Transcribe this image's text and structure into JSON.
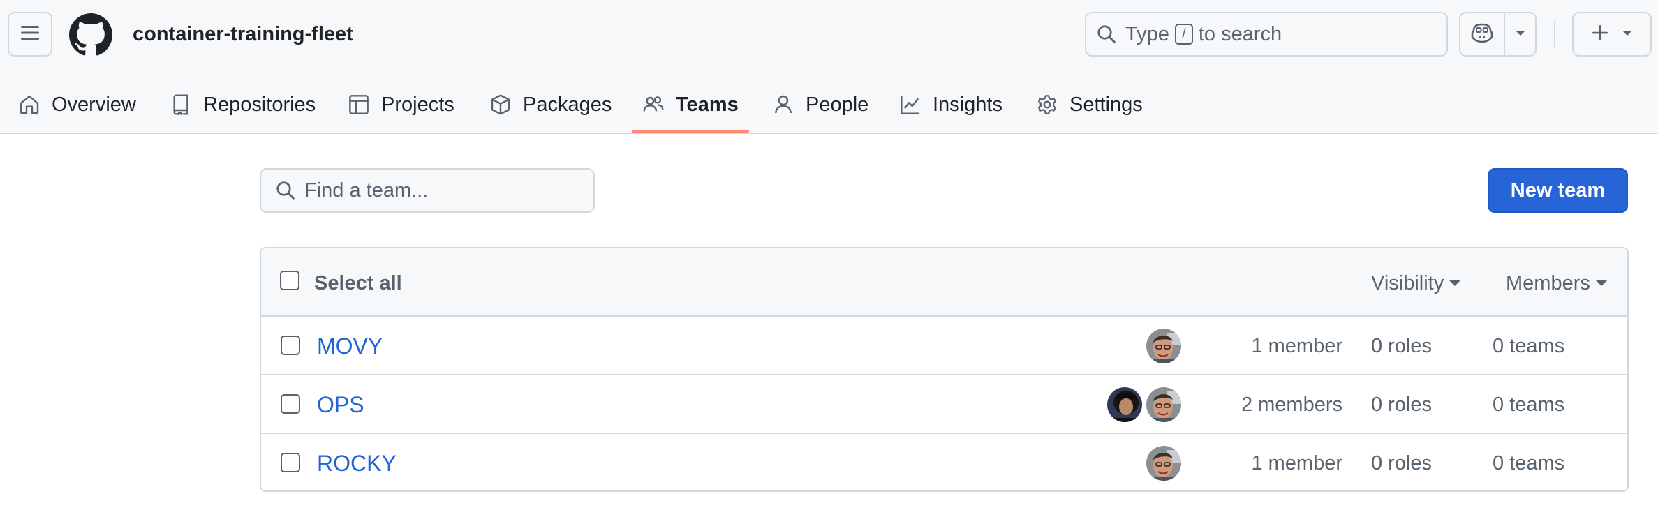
{
  "header": {
    "org_name": "container-training-fleet",
    "search": {
      "prefix": "Type",
      "key": "/",
      "suffix": "to search"
    },
    "icons": {
      "menu": "hamburger-icon",
      "logo": "github-logo",
      "copilot": "copilot-icon",
      "create": "plus-icon"
    }
  },
  "nav": {
    "tabs": [
      {
        "label": "Overview",
        "icon": "home-icon",
        "active": false
      },
      {
        "label": "Repositories",
        "icon": "repo-icon",
        "active": false
      },
      {
        "label": "Projects",
        "icon": "table-icon",
        "active": false
      },
      {
        "label": "Packages",
        "icon": "package-icon",
        "active": false
      },
      {
        "label": "Teams",
        "icon": "people-icon",
        "active": true
      },
      {
        "label": "People",
        "icon": "person-icon",
        "active": false
      },
      {
        "label": "Insights",
        "icon": "graph-icon",
        "active": false
      },
      {
        "label": "Settings",
        "icon": "gear-icon",
        "active": false
      }
    ]
  },
  "main": {
    "find_team_placeholder": "Find a team...",
    "new_team_label": "New team",
    "table": {
      "select_all_label": "Select all",
      "visibility_label": "Visibility",
      "members_label": "Members",
      "rows": [
        {
          "name": "MOVY",
          "avatars": 1,
          "members": "1 member",
          "roles": "0 roles",
          "teams": "0 teams"
        },
        {
          "name": "OPS",
          "avatars": 2,
          "members": "2 members",
          "roles": "0 roles",
          "teams": "0 teams"
        },
        {
          "name": "ROCKY",
          "avatars": 1,
          "members": "1 member",
          "roles": "0 roles",
          "teams": "0 teams"
        }
      ]
    }
  },
  "colors": {
    "accent_tab": "#fd8c73",
    "primary_button": "#2664d8",
    "link": "#1f63d6",
    "muted_text": "#59636e",
    "border": "#d1d9e0",
    "header_bg": "#f6f8fa"
  }
}
